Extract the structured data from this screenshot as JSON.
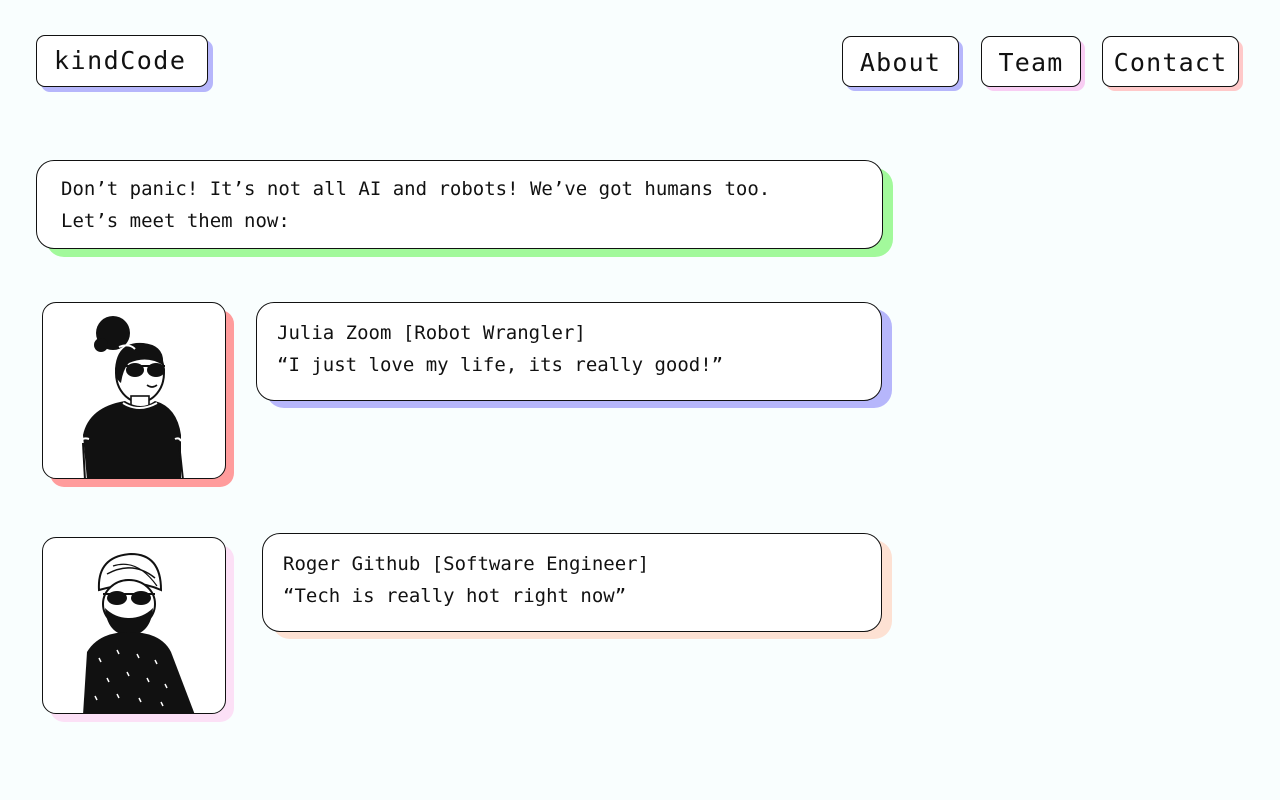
{
  "header": {
    "logo": "kindCode",
    "nav": [
      "About",
      "Team",
      "Contact"
    ]
  },
  "intro": {
    "line1": "Don’t panic! It’s not all AI and robots! We’ve got humans too.",
    "line2": "Let’s meet them now:"
  },
  "team": [
    {
      "name_role": "Julia Zoom [Robot Wrangler]",
      "quote": "“I just love my life, its really good!”",
      "avatar": "woman-sunglasses-illustration"
    },
    {
      "name_role": "Roger Github [Software Engineer]",
      "quote": "“Tech is really hot right now”",
      "avatar": "man-turban-illustration"
    }
  ],
  "colors": {
    "background": "#f9fefe",
    "purple_shadow": "#b6b6fb",
    "pink_shadow": "#f8cdf3",
    "red_shadow": "#ff9c9c",
    "green_shadow": "#a2f99b",
    "peach_shadow": "#fde1d3"
  }
}
